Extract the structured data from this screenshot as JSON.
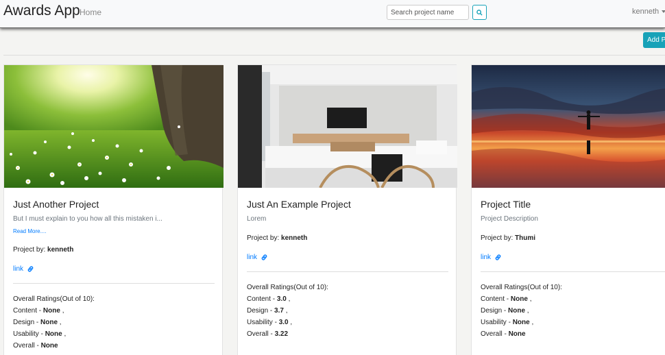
{
  "navbar": {
    "brand": "Awards App",
    "home": "Home",
    "search_placeholder": "Search project name",
    "user": "kenneth"
  },
  "add_button": "Add Project",
  "ratings_heading": "Overall Ratings(Out of 10):",
  "read_more": "Read More....",
  "project_by_label": "Project by:",
  "link_label": "link",
  "rating_labels": {
    "content": "Content - ",
    "design": "Design - ",
    "usability": "Usability - ",
    "overall": "Overall - "
  },
  "cards": [
    {
      "title": "Just Another Project",
      "description": "But I must explain to you how all this mistaken i...",
      "author": "kenneth",
      "ratings": {
        "content": "None",
        "design": "None",
        "usability": "None",
        "overall": "None"
      }
    },
    {
      "title": "Just An Example Project",
      "description": "Lorem",
      "author": "kenneth",
      "ratings": {
        "content": "3.0",
        "design": "3.7",
        "usability": "3.0",
        "overall": "3.22"
      }
    },
    {
      "title": "Project Title",
      "description": "Project Description",
      "author": "Thumi",
      "ratings": {
        "content": "None",
        "design": "None",
        "usability": "None",
        "overall": "None"
      }
    }
  ]
}
